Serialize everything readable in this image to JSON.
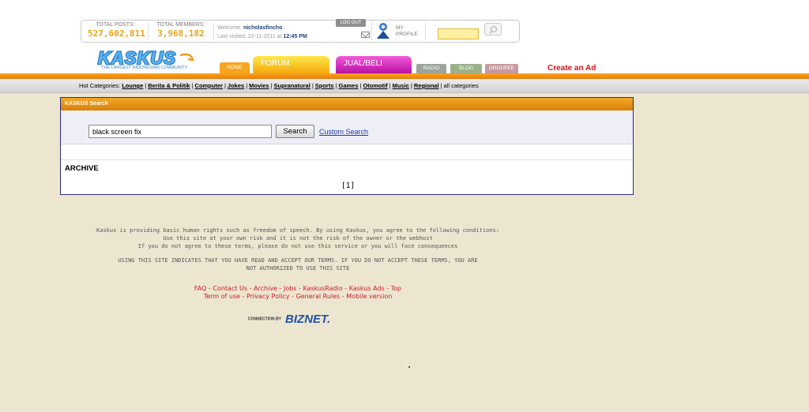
{
  "stats": {
    "total_posts_label": "TOTAL POSTS:",
    "total_posts_value": "527,602,811",
    "total_members_label": "TOTAL MEMBERS:",
    "total_members_value": "3,968,182"
  },
  "welcome": {
    "prefix": "Welcome,",
    "username": "nicholasfincho",
    "suffix": ".",
    "last_visited_label": "Last visited:",
    "last_visited_date": "22-11-2011 at",
    "last_visited_time": "12:45 PM",
    "logout_label": "LOG OUT"
  },
  "profile": {
    "line1": "MY",
    "line2": "PROFILE"
  },
  "logo": {
    "text": "KASKUS",
    "tagline": "THE LARGEST INDONESIAN COMMUNITY"
  },
  "nav": {
    "home": "HOME",
    "forum": "FORUM",
    "jualbeli": "JUAL/BELI",
    "radio": "RADIO",
    "blog": "BLOG",
    "groupee": "GROUPEE",
    "create_ad": "Create an Ad"
  },
  "hot_categories": {
    "label": "Hot Categories:",
    "items": [
      "Lounge",
      "Berita & Politik",
      "Computer",
      "Jokes",
      "Movies",
      "Supranatural",
      "Sports",
      "Games",
      "Otomotif",
      "Music",
      "Regional"
    ],
    "all": "all categories"
  },
  "search": {
    "panel_title": "KASKUS Search",
    "query": "black screen fix",
    "button": "Search",
    "custom_link": "Custom Search"
  },
  "archive": {
    "title": "ARCHIVE",
    "pages": "[1]"
  },
  "footer": {
    "line1": "Kaskus is providing basic human rights such as freedom of speech. By using Kaskus, you agree to the following conditions:",
    "line2": "Use this site at your own risk and it is not the risk of the owner or the webhost",
    "line3": "If you do not agree to these terms, please do not use this service or you will face consequences",
    "line4": "USING THIS SITE INDICATES THAT YOU HAVE READ AND ACCEPT OUR TERMS. IF YOU DO NOT ACCEPT THESE TERMS, YOU ARE",
    "line5": "NOT AUTHORIZED TO USE THIS SITE",
    "links_row1": [
      "FAQ",
      "Contact Us",
      "Archive",
      "Jobs",
      "KaskusRadio",
      "Kaskus Ads",
      "Top"
    ],
    "links_row2": [
      "Term of use",
      "Privacy Policy",
      "General Rules",
      "Mobile version"
    ],
    "connection_label": "CONNECTION BY",
    "connection_brand": "BIZNET."
  },
  "colors": {
    "accent_orange": "#f7a51e",
    "stats_value": "#f0a20c",
    "link_red": "#cc1a24",
    "panel_border": "#2a2e84",
    "background": "#ece6d1"
  }
}
